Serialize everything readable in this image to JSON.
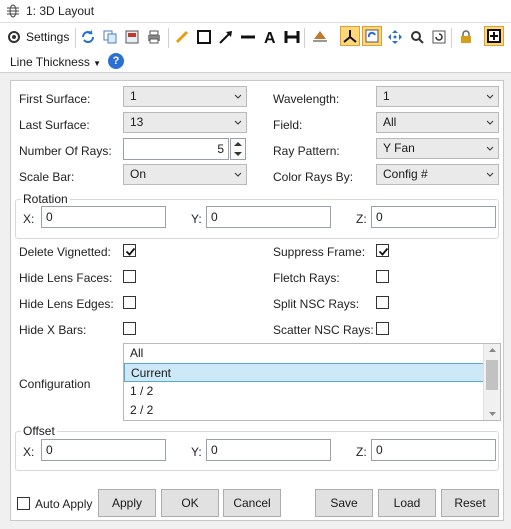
{
  "window": {
    "title": "1: 3D Layout"
  },
  "toolbar": {
    "settings_label": "Settings",
    "line_thickness_label": "Line Thickness",
    "help_glyph": "?",
    "tools": [
      "refresh-icon",
      "copy-icon",
      "export-icon",
      "print-icon",
      "pencil-icon",
      "rectangle-icon",
      "arrow-icon",
      "line-icon",
      "text-icon",
      "dimension-icon",
      "rotate-axes-icon",
      "axes-icon",
      "sync-icon",
      "pan-icon",
      "zoom-icon",
      "reset-icon",
      "lock-icon",
      "fit-icon"
    ]
  },
  "form": {
    "first_surface": {
      "label": "First Surface:",
      "value": "1"
    },
    "last_surface": {
      "label": "Last Surface:",
      "value": "13"
    },
    "number_of_rays": {
      "label": "Number Of Rays:",
      "value": "5"
    },
    "scale_bar": {
      "label": "Scale Bar:",
      "value": "On"
    },
    "wavelength": {
      "label": "Wavelength:",
      "value": "1"
    },
    "field": {
      "label": "Field:",
      "value": "All"
    },
    "ray_pattern": {
      "label": "Ray Pattern:",
      "value": "Y Fan"
    },
    "color_rays_by": {
      "label": "Color Rays By:",
      "value": "Config #"
    },
    "rotation": {
      "label": "Rotation",
      "x_label": "X:",
      "x": "0",
      "y_label": "Y:",
      "y": "0",
      "z_label": "Z:",
      "z": "0"
    },
    "checks": {
      "delete_vignetted": {
        "label": "Delete Vignetted:",
        "checked": true
      },
      "hide_lens_faces": {
        "label": "Hide Lens Faces:",
        "checked": false
      },
      "hide_lens_edges": {
        "label": "Hide Lens Edges:",
        "checked": false
      },
      "hide_x_bars": {
        "label": "Hide X Bars:",
        "checked": false
      },
      "suppress_frame": {
        "label": "Suppress Frame:",
        "checked": true
      },
      "fletch_rays": {
        "label": "Fletch Rays:",
        "checked": false
      },
      "split_nsc_rays": {
        "label": "Split NSC Rays:",
        "checked": false
      },
      "scatter_nsc_rays": {
        "label": "Scatter NSC Rays:",
        "checked": false
      }
    },
    "configuration": {
      "label": "Configuration",
      "options": [
        "All",
        "Current",
        "1 / 2",
        "2 / 2"
      ],
      "selected": "Current"
    },
    "offset": {
      "label": "Offset",
      "x_label": "X:",
      "x": "0",
      "y_label": "Y:",
      "y": "0",
      "z_label": "Z:",
      "z": "0"
    }
  },
  "footer": {
    "auto_apply_label": "Auto Apply",
    "auto_apply_checked": false,
    "apply": "Apply",
    "ok": "OK",
    "cancel": "Cancel",
    "save": "Save",
    "load": "Load",
    "reset": "Reset"
  }
}
